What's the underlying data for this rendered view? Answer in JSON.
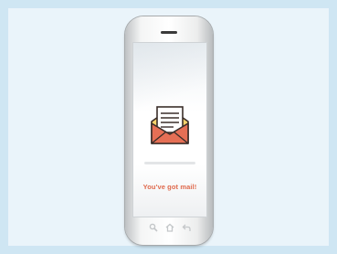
{
  "screen": {
    "message": "You've got mail!"
  },
  "icons": {
    "envelope": "open-envelope-with-letter-icon",
    "nav_left": "search-icon",
    "nav_center": "home-icon",
    "nav_right": "back-icon"
  },
  "colors": {
    "background": "#cfe6f3",
    "panel": "#eaf4fa",
    "accent": "#e06a4d",
    "envelope_red": "#e56f55",
    "letter_yellow": "#f7d36b"
  }
}
